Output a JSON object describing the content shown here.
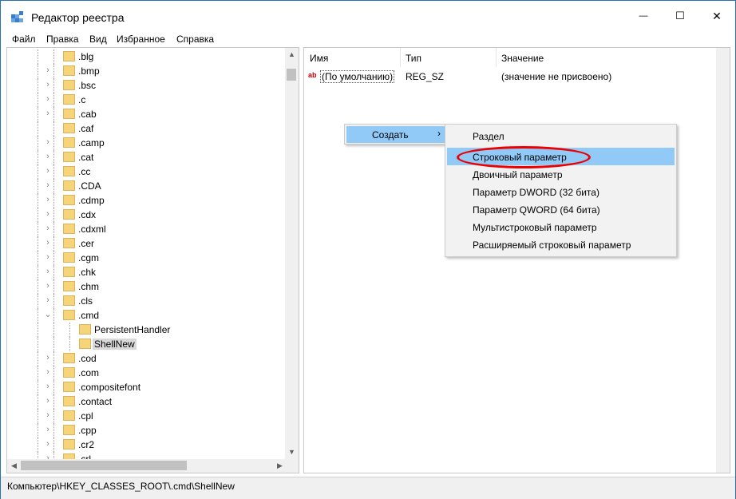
{
  "window": {
    "title": "Редактор реестра",
    "minimize_glyph": "—",
    "maximize_glyph": "☐",
    "close_glyph": "✕"
  },
  "menu": [
    "Файл",
    "Правка",
    "Вид",
    "Избранное",
    "Справка"
  ],
  "tree": {
    "items": [
      {
        "label": ".blg",
        "expander": "none",
        "level": 1
      },
      {
        "label": ".bmp",
        "expander": "collapsed",
        "level": 1
      },
      {
        "label": ".bsc",
        "expander": "collapsed",
        "level": 1
      },
      {
        "label": ".c",
        "expander": "collapsed",
        "level": 1
      },
      {
        "label": ".cab",
        "expander": "collapsed",
        "level": 1
      },
      {
        "label": ".caf",
        "expander": "none",
        "level": 1
      },
      {
        "label": ".camp",
        "expander": "collapsed",
        "level": 1
      },
      {
        "label": ".cat",
        "expander": "collapsed",
        "level": 1
      },
      {
        "label": ".cc",
        "expander": "collapsed",
        "level": 1
      },
      {
        "label": ".CDA",
        "expander": "collapsed",
        "level": 1
      },
      {
        "label": ".cdmp",
        "expander": "collapsed",
        "level": 1
      },
      {
        "label": ".cdx",
        "expander": "collapsed",
        "level": 1
      },
      {
        "label": ".cdxml",
        "expander": "collapsed",
        "level": 1
      },
      {
        "label": ".cer",
        "expander": "collapsed",
        "level": 1
      },
      {
        "label": ".cgm",
        "expander": "collapsed",
        "level": 1
      },
      {
        "label": ".chk",
        "expander": "collapsed",
        "level": 1
      },
      {
        "label": ".chm",
        "expander": "collapsed",
        "level": 1
      },
      {
        "label": ".cls",
        "expander": "collapsed",
        "level": 1
      },
      {
        "label": ".cmd",
        "expander": "expanded",
        "level": 1
      },
      {
        "label": "PersistentHandler",
        "expander": "none",
        "level": 2
      },
      {
        "label": "ShellNew",
        "expander": "none",
        "level": 2,
        "selected": true
      },
      {
        "label": ".cod",
        "expander": "collapsed",
        "level": 1
      },
      {
        "label": ".com",
        "expander": "collapsed",
        "level": 1
      },
      {
        "label": ".compositefont",
        "expander": "collapsed",
        "level": 1
      },
      {
        "label": ".contact",
        "expander": "collapsed",
        "level": 1
      },
      {
        "label": ".cpl",
        "expander": "collapsed",
        "level": 1
      },
      {
        "label": ".cpp",
        "expander": "collapsed",
        "level": 1
      },
      {
        "label": ".cr2",
        "expander": "collapsed",
        "level": 1
      },
      {
        "label": ".crl",
        "expander": "collapsed",
        "level": 1
      }
    ]
  },
  "values_table": {
    "headers": [
      "Имя",
      "Тип",
      "Значение"
    ],
    "rows": [
      {
        "name": "(По умолчанию)",
        "type": "REG_SZ",
        "value": "(значение не присвоено)",
        "icon": "ab-string-icon"
      }
    ]
  },
  "context_menu": {
    "item": "Создать",
    "arrow": "›"
  },
  "submenu": {
    "items": [
      {
        "label": "Раздел",
        "highlighted": false
      },
      {
        "label": "Строковый параметр",
        "highlighted": true
      },
      {
        "label": "Двоичный параметр",
        "highlighted": false
      },
      {
        "label": "Параметр DWORD (32 бита)",
        "highlighted": false
      },
      {
        "label": "Параметр QWORD (64 бита)",
        "highlighted": false
      },
      {
        "label": "Мультистроковый параметр",
        "highlighted": false
      },
      {
        "label": "Расширяемый строковый параметр",
        "highlighted": false
      }
    ]
  },
  "status": {
    "path": "Компьютер\\HKEY_CLASSES_ROOT\\.cmd\\ShellNew"
  },
  "colors": {
    "selection": "#91c9f7",
    "annotation_ring": "#e00000",
    "folder": "#f5d47a"
  }
}
